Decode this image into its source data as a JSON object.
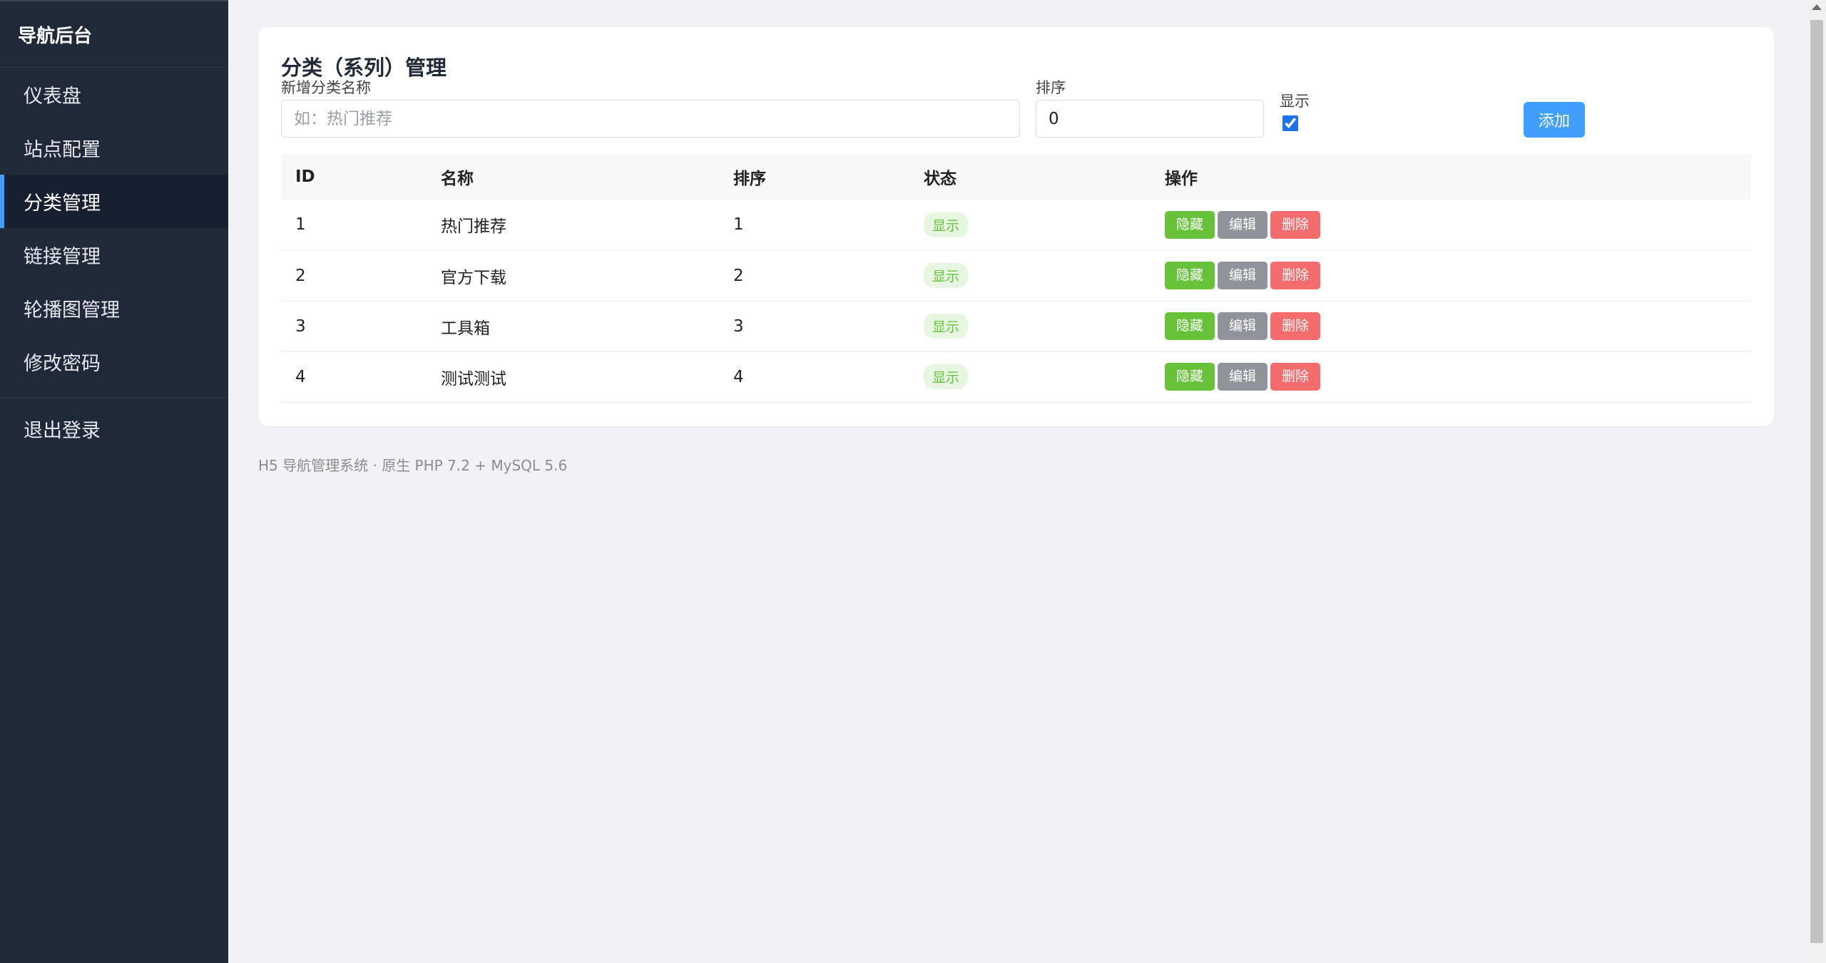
{
  "sidebar": {
    "brand": "导航后台",
    "items": [
      {
        "label": "仪表盘"
      },
      {
        "label": "站点配置"
      },
      {
        "label": "分类管理"
      },
      {
        "label": "链接管理"
      },
      {
        "label": "轮播图管理"
      },
      {
        "label": "修改密码"
      }
    ],
    "logout": "退出登录"
  },
  "page": {
    "title": "分类（系列）管理"
  },
  "form": {
    "name_label": "新增分类名称",
    "name_placeholder": "如：热门推荐",
    "sort_label": "排序",
    "sort_value": "0",
    "show_label": "显示",
    "show_checked": true,
    "add_button": "添加"
  },
  "table": {
    "headers": [
      "ID",
      "名称",
      "排序",
      "状态",
      "操作"
    ],
    "rows": [
      {
        "id": "1",
        "name": "热门推荐",
        "sort": "1",
        "status": "显示"
      },
      {
        "id": "2",
        "name": "官方下载",
        "sort": "2",
        "status": "显示"
      },
      {
        "id": "3",
        "name": "工具箱",
        "sort": "3",
        "status": "显示"
      },
      {
        "id": "4",
        "name": "测试测试",
        "sort": "4",
        "status": "显示"
      }
    ],
    "actions": {
      "hide": "隐藏",
      "edit": "编辑",
      "delete": "删除"
    }
  },
  "footer": "H5 导航管理系统 · 原生 PHP 7.2 + MySQL 5.6",
  "colors": {
    "sidebar_bg": "#1f2937",
    "accent": "#409eff",
    "hide_btn": "#67c23a",
    "edit_btn": "#909399",
    "delete_btn": "#f56c6c"
  }
}
